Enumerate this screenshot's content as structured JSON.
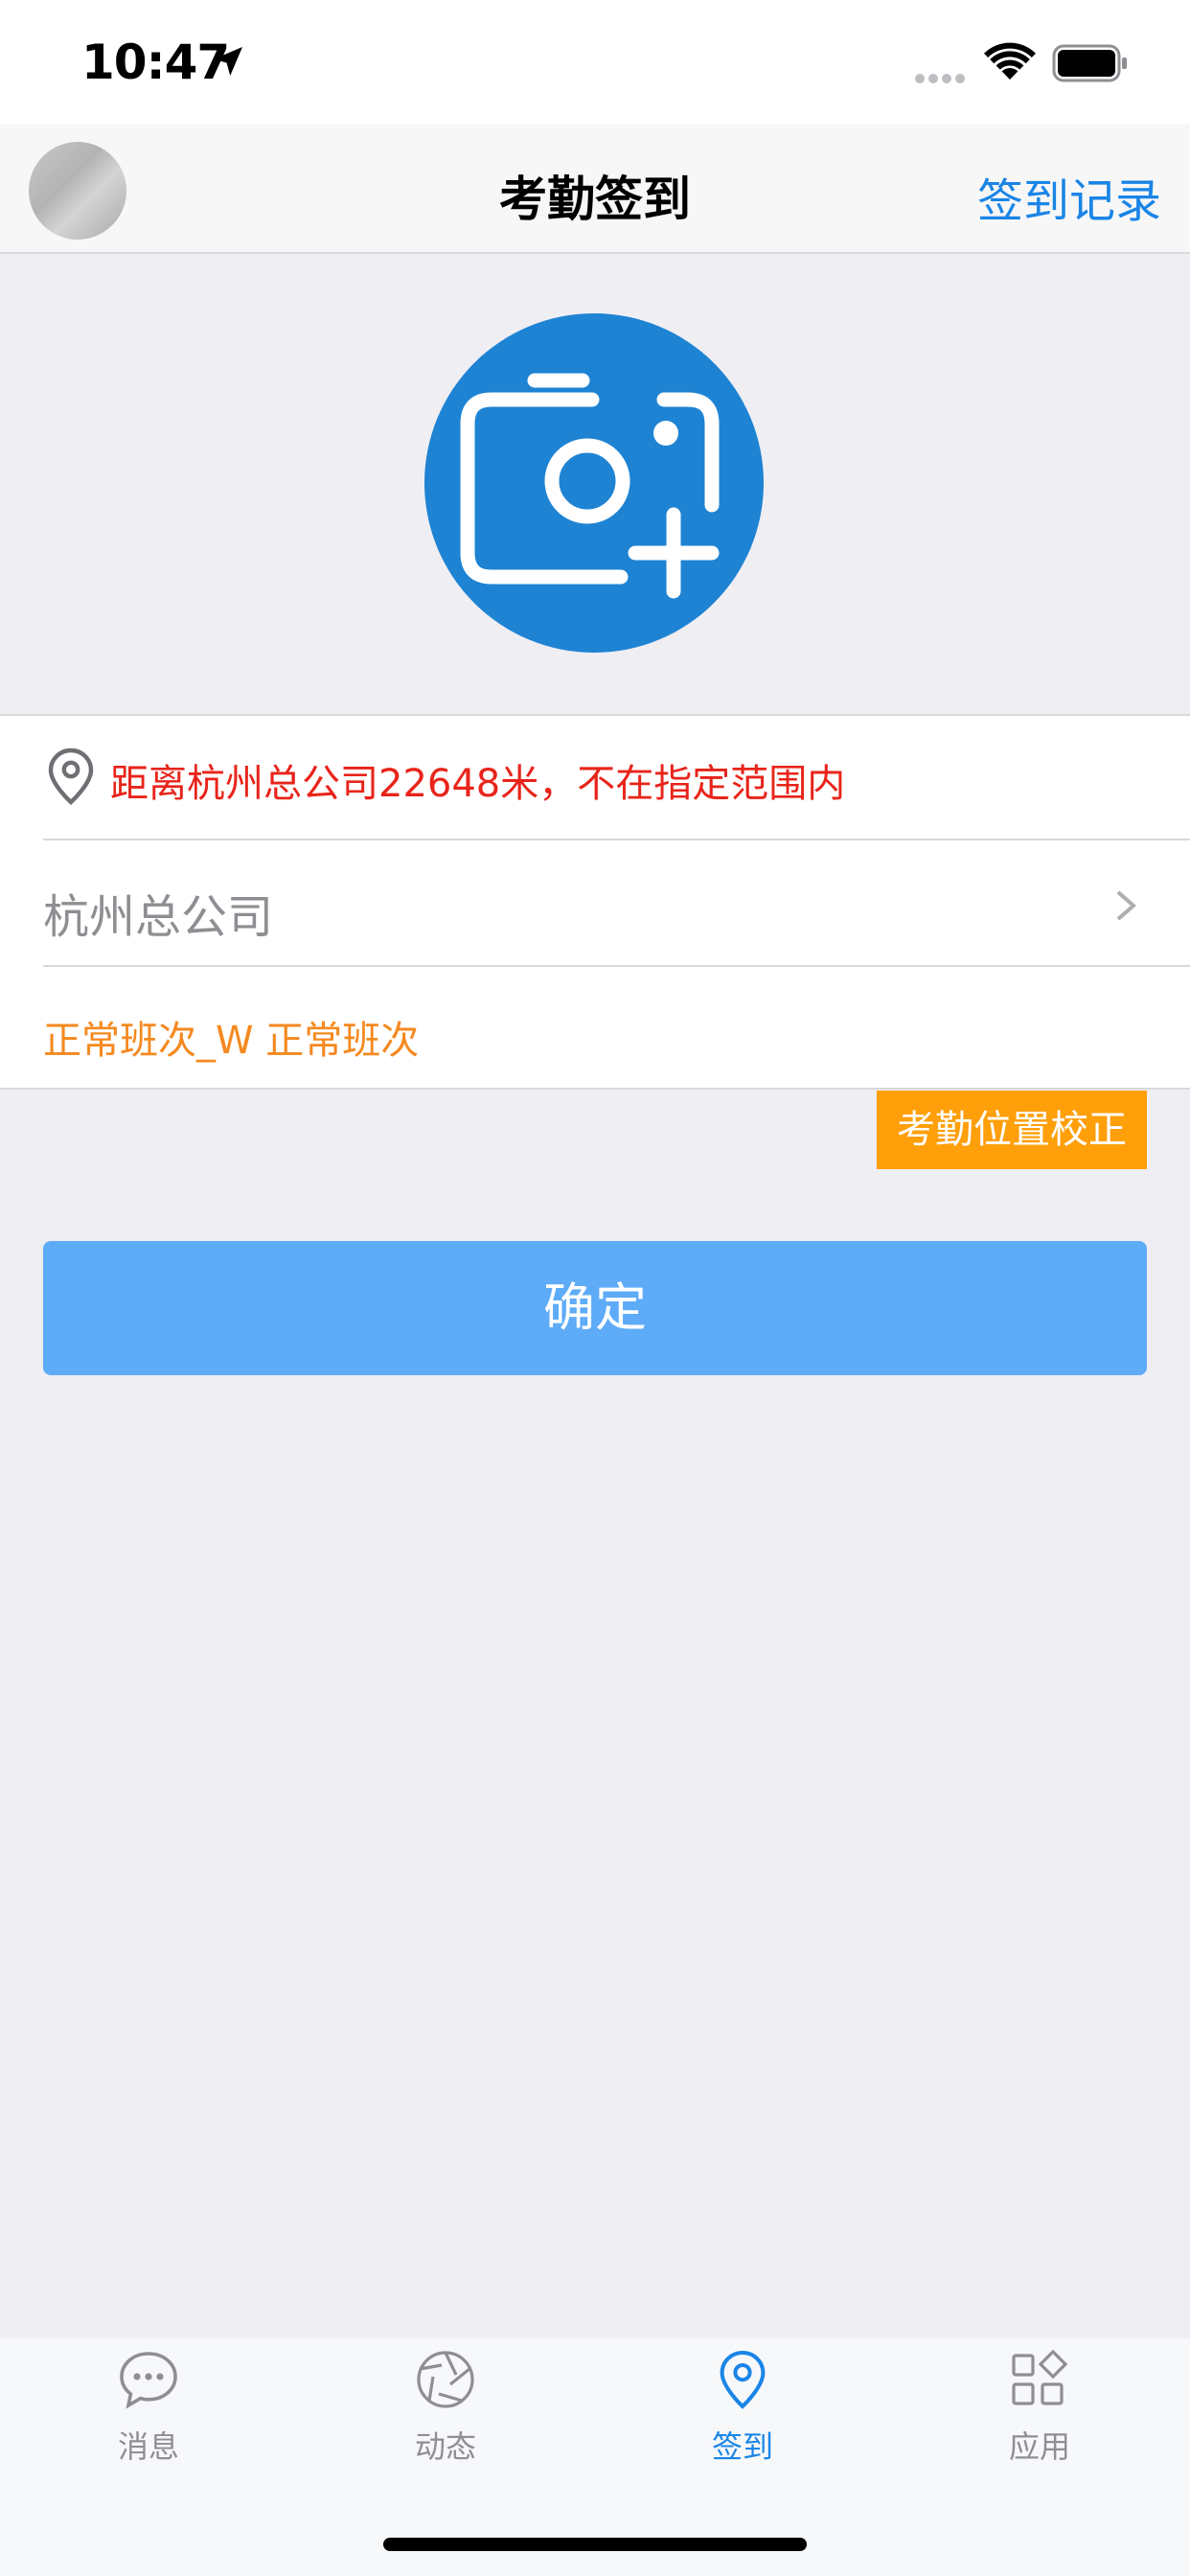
{
  "status_bar": {
    "time": "10:47",
    "icons": [
      "location-arrow-icon",
      "cellular-icon",
      "wifi-icon",
      "battery-icon"
    ]
  },
  "nav": {
    "title": "考勤签到",
    "right_action": "签到记录",
    "avatar_icon": "avatar"
  },
  "camera": {
    "icon": "camera-plus-icon",
    "color": "#1E83D3"
  },
  "location": {
    "distance_message": "距离杭州总公司22648米，不在指定范围内",
    "icon": "map-pin-icon",
    "status_color": "#E8241A"
  },
  "company": {
    "name": "杭州总公司",
    "icon": "chevron-right-icon"
  },
  "shift": {
    "label": "正常班次_W 正常班次",
    "color": "#F5891F"
  },
  "actions": {
    "calibrate_label": "考勤位置校正",
    "confirm_label": "确定"
  },
  "tabs": [
    {
      "label": "消息",
      "icon": "message-bubble-icon",
      "active": false
    },
    {
      "label": "动态",
      "icon": "aperture-icon",
      "active": false
    },
    {
      "label": "签到",
      "icon": "location-pin-icon",
      "active": true
    },
    {
      "label": "应用",
      "icon": "apps-grid-icon",
      "active": false
    }
  ],
  "colors": {
    "accent": "#1A85E6",
    "confirm_button": "#5EABF8",
    "calibrate_button": "#FF9F0A",
    "background": "#EFEEF3"
  }
}
